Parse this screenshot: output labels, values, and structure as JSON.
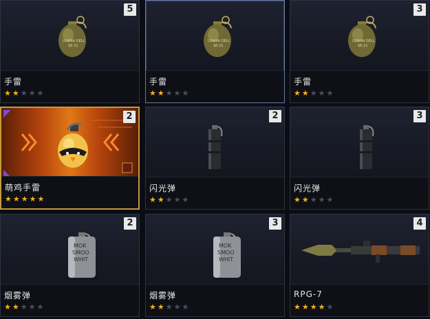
{
  "items": [
    {
      "name": "手雷",
      "stars": 2,
      "count": "5",
      "kind": "grenade"
    },
    {
      "name": "手雷",
      "stars": 2,
      "count": "",
      "kind": "grenade"
    },
    {
      "name": "手雷",
      "stars": 2,
      "count": "3",
      "kind": "grenade"
    },
    {
      "name": "萌鸡手雷",
      "stars": 5,
      "count": "2",
      "kind": "chick-grenade"
    },
    {
      "name": "闪光弹",
      "stars": 2,
      "count": "2",
      "kind": "flashbang"
    },
    {
      "name": "闪光弹",
      "stars": 2,
      "count": "3",
      "kind": "flashbang"
    },
    {
      "name": "烟雾弹",
      "stars": 2,
      "count": "2",
      "kind": "smoke"
    },
    {
      "name": "烟雾弹",
      "stars": 2,
      "count": "3",
      "kind": "smoke"
    },
    {
      "name": "RPG-7",
      "stars": 4,
      "count": "4",
      "kind": "rpg"
    }
  ],
  "grenade_text": [
    "LOWRA DELL",
    "SE-21"
  ],
  "smoke_text": [
    "MOK",
    "SMOO",
    "WHIT"
  ],
  "max_stars": 5,
  "colors": {
    "star_on": "#f2b31a",
    "star_off": "#4b5060",
    "gold_border": "#c79a3a"
  }
}
